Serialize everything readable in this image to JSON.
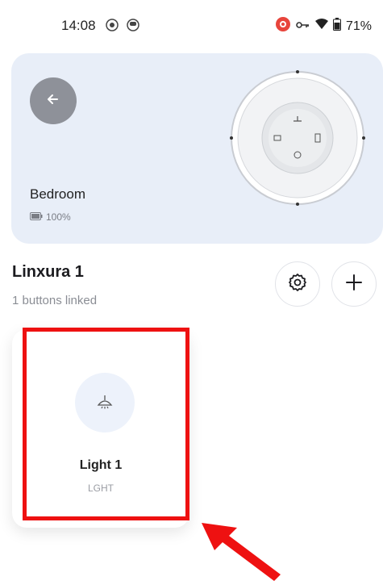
{
  "status_bar": {
    "time": "14:08",
    "battery": "71%",
    "icons": [
      "record-icon",
      "notification-icon",
      "camera-in-use-icon",
      "key-icon",
      "wifi-icon",
      "battery-icon"
    ]
  },
  "device_card": {
    "room": "Bedroom",
    "battery": "100%",
    "background": "#e8eef8"
  },
  "device": {
    "name": "Linxura 1",
    "subtitle": "1 buttons linked"
  },
  "buttons": [
    {
      "name": "Light 1",
      "code": "LGHT",
      "icon": "ceiling-light-icon"
    }
  ],
  "colors": {
    "accent_highlight": "#ee1111",
    "back_button": "#8e9199"
  }
}
